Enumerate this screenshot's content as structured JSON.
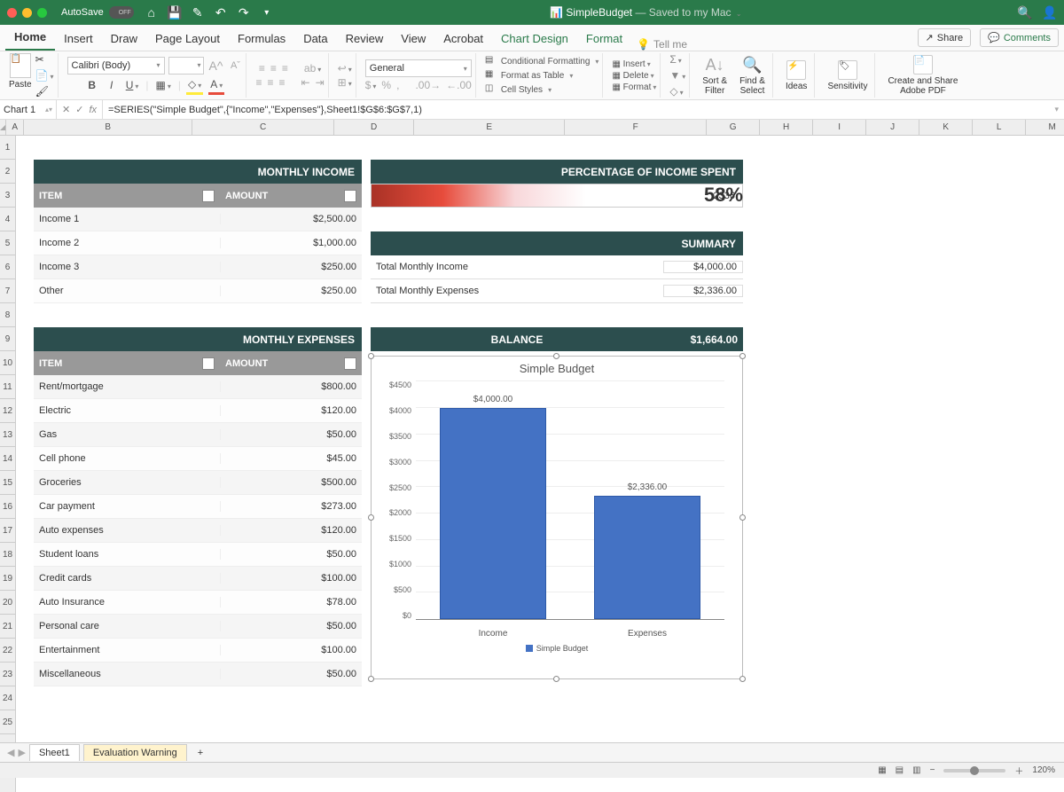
{
  "titlebar": {
    "autosave_label": "AutoSave",
    "autosave_state": "OFF",
    "doc_name": "SimpleBudget",
    "doc_status": "— Saved to my Mac"
  },
  "tabs": [
    "Home",
    "Insert",
    "Draw",
    "Page Layout",
    "Formulas",
    "Data",
    "Review",
    "View",
    "Acrobat",
    "Chart Design",
    "Format"
  ],
  "active_tab": "Home",
  "tellme": "Tell me",
  "share": "Share",
  "comments": "Comments",
  "ribbon": {
    "paste": "Paste",
    "font_name": "Calibri (Body)",
    "font_size": "",
    "number_format": "General",
    "cond_fmt": "Conditional Formatting",
    "fmt_table": "Format as Table",
    "cell_styles": "Cell Styles",
    "insert": "Insert",
    "delete": "Delete",
    "format": "Format",
    "sort_filter": "Sort &\nFilter",
    "find_select": "Find &\nSelect",
    "ideas": "Ideas",
    "sensitivity": "Sensitivity",
    "adobe": "Create and Share\nAdobe PDF"
  },
  "fx": {
    "namebox": "Chart 1",
    "formula": "=SERIES(\"Simple Budget\",{\"Income\",\"Expenses\"},Sheet1!$G$6:$G$7,1)"
  },
  "cols": [
    "A",
    "B",
    "C",
    "D",
    "E",
    "F",
    "G",
    "H",
    "I",
    "J",
    "K",
    "L",
    "M"
  ],
  "rows": 25,
  "income": {
    "header": "MONTHLY INCOME",
    "col_item": "ITEM",
    "col_amount": "AMOUNT",
    "items": [
      {
        "item": "Income 1",
        "amount": "$2,500.00"
      },
      {
        "item": "Income 2",
        "amount": "$1,000.00"
      },
      {
        "item": "Income 3",
        "amount": "$250.00"
      },
      {
        "item": "Other",
        "amount": "$250.00"
      }
    ]
  },
  "expenses": {
    "header": "MONTHLY EXPENSES",
    "col_item": "ITEM",
    "col_amount": "AMOUNT",
    "items": [
      {
        "item": "Rent/mortgage",
        "amount": "$800.00"
      },
      {
        "item": "Electric",
        "amount": "$120.00"
      },
      {
        "item": "Gas",
        "amount": "$50.00"
      },
      {
        "item": "Cell phone",
        "amount": "$45.00"
      },
      {
        "item": "Groceries",
        "amount": "$500.00"
      },
      {
        "item": "Car payment",
        "amount": "$273.00"
      },
      {
        "item": "Auto expenses",
        "amount": "$120.00"
      },
      {
        "item": "Student loans",
        "amount": "$50.00"
      },
      {
        "item": "Credit cards",
        "amount": "$100.00"
      },
      {
        "item": "Auto Insurance",
        "amount": "$78.00"
      },
      {
        "item": "Personal care",
        "amount": "$50.00"
      },
      {
        "item": "Entertainment",
        "amount": "$100.00"
      },
      {
        "item": "Miscellaneous",
        "amount": "$50.00"
      }
    ]
  },
  "pct": {
    "header": "PERCENTAGE OF INCOME SPENT",
    "value": "2336",
    "percent": "58%"
  },
  "summary": {
    "header": "SUMMARY",
    "rows": [
      {
        "lbl": "Total Monthly Income",
        "amt": "$4,000.00"
      },
      {
        "lbl": "Total Monthly Expenses",
        "amt": "$2,336.00"
      }
    ]
  },
  "balance": {
    "label": "BALANCE",
    "amount": "$1,664.00"
  },
  "chart_data": {
    "type": "bar",
    "title": "Simple Budget",
    "categories": [
      "Income",
      "Expenses"
    ],
    "values": [
      4000,
      2336
    ],
    "value_labels": [
      "$4,000.00",
      "$2,336.00"
    ],
    "ylim": [
      0,
      4500
    ],
    "yticks": [
      "$4500",
      "$4000",
      "$3500",
      "$3000",
      "$2500",
      "$2000",
      "$1500",
      "$1000",
      "$500",
      "$0"
    ],
    "legend": "Simple Budget"
  },
  "sheets": {
    "tab1": "Sheet1",
    "warn": "Evaluation Warning",
    "add": "+"
  },
  "status": {
    "zoom": "120%"
  }
}
